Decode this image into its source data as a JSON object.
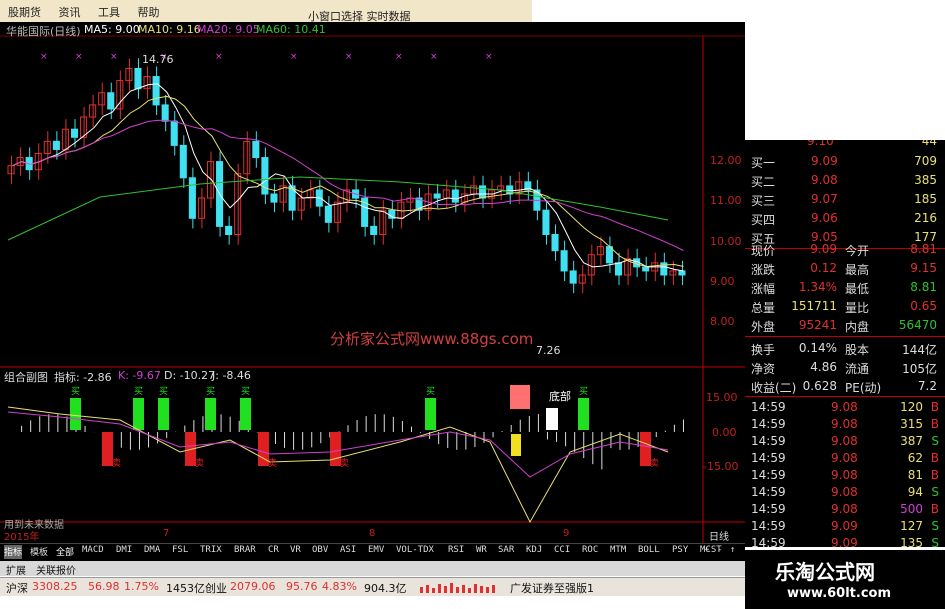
{
  "menu": [
    "股期货",
    "资讯",
    "工具",
    "帮助"
  ],
  "top_red_text": "小窗口选择  实时数据",
  "main_chart": {
    "stock_name": "华能国际(日线)",
    "ma5": "MA5: 9.00",
    "ma10": "MA10: 9.16",
    "ma20": "MA20: 9.05",
    "ma60": "MA60: 10.41",
    "high_label": "14.76",
    "low_label": "7.26",
    "watermark": "分析家公式网www.88gs.com",
    "y_ticks": [
      "12.00",
      "11.00",
      "10.00",
      "9.00",
      "8.00"
    ]
  },
  "sub_chart": {
    "title": "组合副图",
    "indicator": "指标: -2.86",
    "k": "K: -9.67",
    "d": "D: -10.27",
    "j": "J: -8.46",
    "y_ticks": [
      "15.00",
      "0.00",
      "-15.00"
    ],
    "bottom_text": "用到未来数据",
    "bottom_label": "底部",
    "buy_mark": "买",
    "sell_mark": "卖"
  },
  "x_axis": {
    "year": "2015年",
    "months": [
      "7",
      "8",
      "9"
    ],
    "period": "日线"
  },
  "toolbar": {
    "items": [
      "指标",
      "模板",
      "全部",
      "MACD",
      "DMI",
      "DMA",
      "FSL",
      "TRIX",
      "BRAR",
      "CR",
      "VR",
      "OBV",
      "ASI",
      "EMV",
      "VOL-TDX",
      "RSI",
      "WR",
      "SAR",
      "KDJ",
      "CCI",
      "ROC",
      "MTM",
      "BOLL",
      "PSY",
      "MCST"
    ],
    "controls": [
      "+",
      "-",
      "↑"
    ]
  },
  "tabs": [
    "扩展",
    "关联报价"
  ],
  "orderbook": [
    {
      "label": "买一",
      "price": "9.09",
      "volume": "709"
    },
    {
      "label": "买二",
      "price": "9.08",
      "volume": "385"
    },
    {
      "label": "买三",
      "price": "9.07",
      "volume": "185"
    },
    {
      "label": "买四",
      "price": "9.06",
      "volume": "216"
    },
    {
      "label": "买五",
      "price": "9.05",
      "volume": "177"
    }
  ],
  "orderbook_top": {
    "price": "9.10",
    "volume": "44"
  },
  "quote": [
    {
      "l1": "现价",
      "v1": "9.09",
      "l2": "今开",
      "v2": "8.81"
    },
    {
      "l1": "涨跌",
      "v1": "0.12",
      "l2": "最高",
      "v2": "9.15"
    },
    {
      "l1": "涨幅",
      "v1": "1.34%",
      "l2": "最低",
      "v2": "8.81"
    },
    {
      "l1": "总量",
      "v1": "151711",
      "l2": "量比",
      "v2": "0.65"
    },
    {
      "l1": "外盘",
      "v1": "95241",
      "l2": "内盘",
      "v2": "56470"
    },
    {
      "l1": "换手",
      "v1": "0.14%",
      "l2": "股本",
      "v2": "144亿"
    },
    {
      "l1": "净资",
      "v1": "4.86",
      "l2": "流通",
      "v2": "105亿"
    },
    {
      "l1": "收益(二)",
      "v1": "0.628",
      "l2": "PE(动)",
      "v2": "7.2"
    }
  ],
  "ticks": [
    {
      "time": "14:59",
      "price": "9.08",
      "vol": "120",
      "side": "B"
    },
    {
      "time": "14:59",
      "price": "9.08",
      "vol": "315",
      "side": "B"
    },
    {
      "time": "14:59",
      "price": "9.08",
      "vol": "387",
      "side": "S"
    },
    {
      "time": "14:59",
      "price": "9.08",
      "vol": "62",
      "side": "B"
    },
    {
      "time": "14:59",
      "price": "9.08",
      "vol": "81",
      "side": "B"
    },
    {
      "time": "14:59",
      "price": "9.08",
      "vol": "94",
      "side": "S"
    },
    {
      "time": "14:59",
      "price": "9.08",
      "vol": "500",
      "side": "B"
    },
    {
      "time": "14:59",
      "price": "9.09",
      "vol": "127",
      "side": "S"
    },
    {
      "time": "14:59",
      "price": "9.09",
      "vol": "135",
      "side": "S"
    },
    {
      "time": "15:00",
      "price": "9.09",
      "vol": "1072",
      "side": "B"
    }
  ],
  "status": {
    "sh_name": "沪深",
    "sh_val": "3308.25",
    "sh_chg": "56.98",
    "sh_pct": "1.75%",
    "sh_amt": "1453亿",
    "cy_name": "创业",
    "cy_val": "2079.06",
    "cy_chg": "95.76",
    "cy_pct": "4.83%",
    "cy_amt": "904.3亿",
    "broker": "广发证券至强版1"
  },
  "logo": {
    "title": "乐淘公式网",
    "url": "www.60lt.com"
  },
  "colors": {
    "up": "#e03030",
    "down": "#40e0f0",
    "ma5": "#ffffff",
    "ma10": "#e8e070",
    "ma20": "#d040d0",
    "ma60": "#30c030",
    "axis": "#c00000"
  }
}
